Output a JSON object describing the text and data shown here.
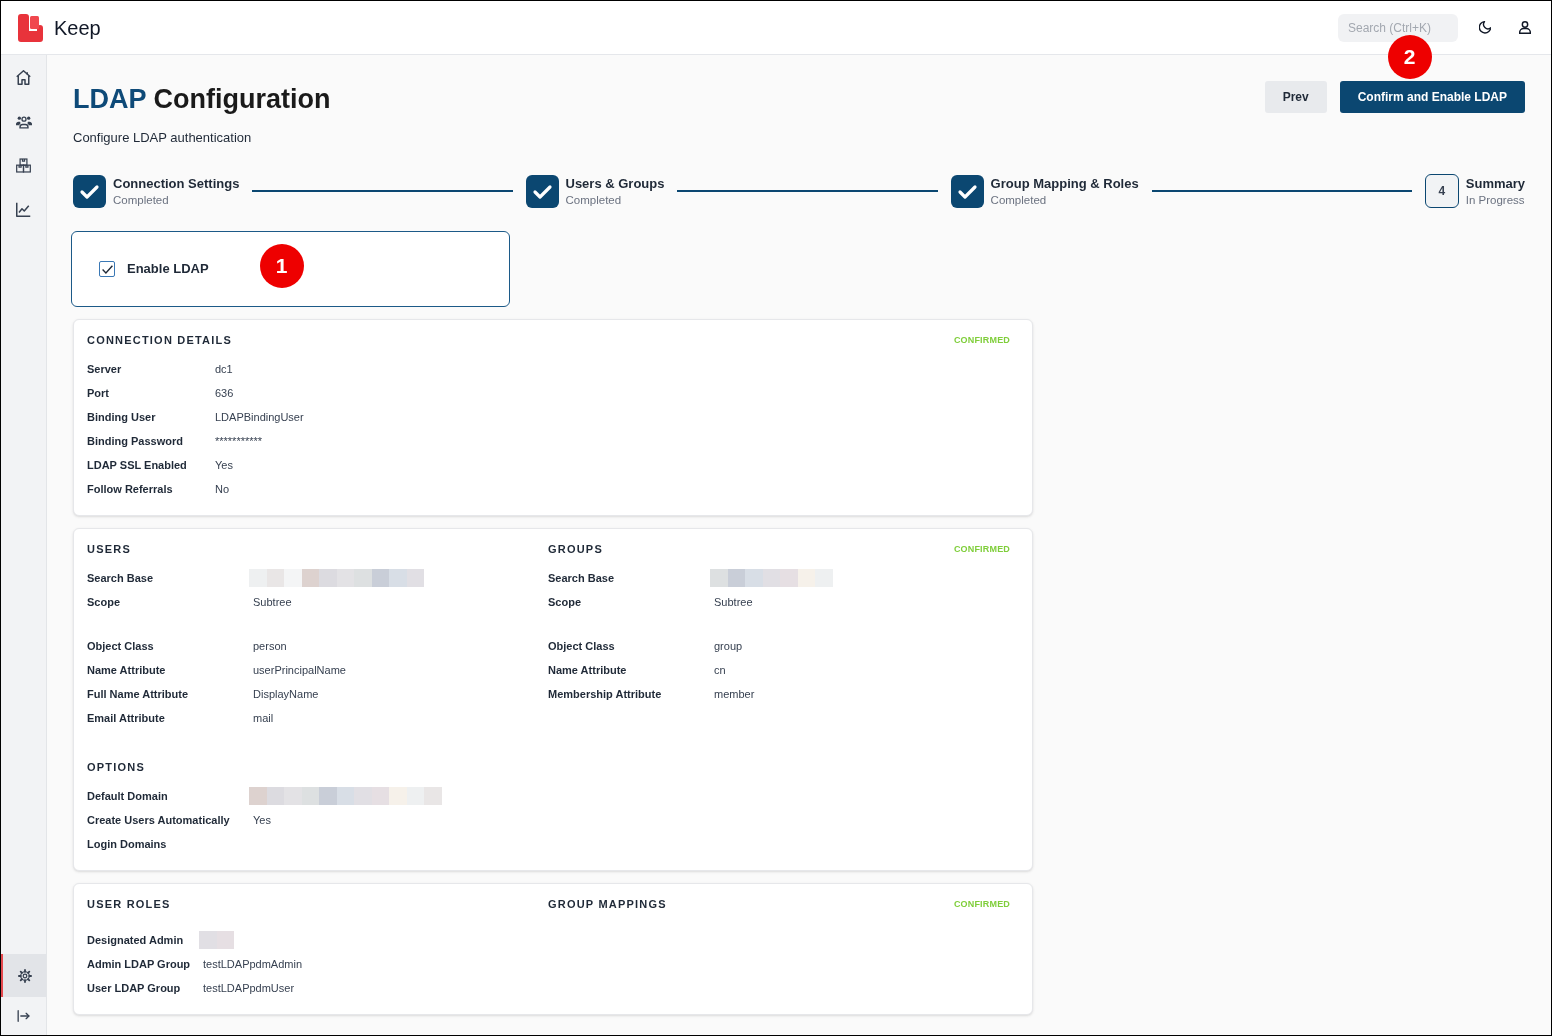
{
  "app": {
    "name": "Keep"
  },
  "header": {
    "search": {
      "placeholder": "Search (Ctrl+K)"
    }
  },
  "sidebar": {
    "items": [
      {
        "selected": false
      },
      {
        "selected": false
      },
      {
        "selected": false
      },
      {
        "selected": false
      },
      {
        "selected": true
      }
    ]
  },
  "page": {
    "title": [
      {
        "text": "LDAP",
        "accent": true
      },
      {
        "text": "Configuration",
        "accent": false
      }
    ],
    "subtitle": "Configure LDAP authentication",
    "buttons": [
      {
        "label": "Prev",
        "kind": "secondary"
      },
      {
        "label": "Confirm and Enable LDAP",
        "kind": "primary",
        "callout": "2"
      }
    ]
  },
  "steps": [
    {
      "title": "Connection Settings",
      "status": "Completed",
      "completed": true
    },
    {
      "title": "Users & Groups",
      "status": "Completed",
      "completed": true
    },
    {
      "title": "Group Mapping & Roles",
      "status": "Completed",
      "completed": true
    },
    {
      "number": "4",
      "title": "Summary",
      "status": "In Progress",
      "completed": false
    }
  ],
  "enable_ldap": {
    "label": "Enable LDAP",
    "checked": true,
    "callout": "1"
  },
  "cards": [
    {
      "status": "CONFIRMED",
      "columns": [
        {
          "sections": [
            {
              "title": "CONNECTION DETAILS",
              "field_groups": [
                [
                  {
                    "label": "Server",
                    "value": "dc1"
                  },
                  {
                    "label": "Port",
                    "value": "636"
                  },
                  {
                    "label": "Binding User",
                    "value": "LDAPBindingUser"
                  },
                  {
                    "label": "Binding Password",
                    "value": "***********"
                  },
                  {
                    "label": "LDAP SSL Enabled",
                    "value": "Yes"
                  },
                  {
                    "label": "Follow Referrals",
                    "value": "No"
                  }
                ]
              ]
            }
          ]
        }
      ]
    },
    {
      "status": "CONFIRMED",
      "columns": [
        {
          "sections": [
            {
              "title": "USERS",
              "field_groups": [
                [
                  {
                    "label": "Search Base",
                    "redacted": true
                  },
                  {
                    "label": "Scope",
                    "value": "Subtree"
                  }
                ],
                [
                  {
                    "label": "Object Class",
                    "value": "person"
                  },
                  {
                    "label": "Name Attribute",
                    "value": "userPrincipalName"
                  },
                  {
                    "label": "Full Name Attribute",
                    "value": "DisplayName"
                  },
                  {
                    "label": "Email Attribute",
                    "value": "mail"
                  }
                ]
              ]
            },
            {
              "title": "OPTIONS",
              "field_groups": [
                [
                  {
                    "label": "Default Domain",
                    "redacted": true
                  },
                  {
                    "label": "Create Users Automatically",
                    "value": "Yes"
                  },
                  {
                    "label": "Login Domains"
                  }
                ]
              ]
            }
          ]
        },
        {
          "sections": [
            {
              "title": "GROUPS",
              "field_groups": [
                [
                  {
                    "label": "Search Base",
                    "redacted": true
                  },
                  {
                    "label": "Scope",
                    "value": "Subtree"
                  }
                ],
                [
                  {
                    "label": "Object Class",
                    "value": "group"
                  },
                  {
                    "label": "Name Attribute",
                    "value": "cn"
                  },
                  {
                    "label": "Membership Attribute",
                    "value": "member"
                  }
                ]
              ]
            }
          ]
        }
      ]
    },
    {
      "status": "CONFIRMED",
      "columns": [
        {
          "sections": [
            {
              "title": "USER ROLES",
              "field_groups": [
                [
                  {
                    "label": "Designated Admin",
                    "redacted": true
                  },
                  {
                    "label": "Admin LDAP Group",
                    "value": "testLDAPpdmAdmin"
                  },
                  {
                    "label": "User LDAP Group",
                    "value": "testLDAPpdmUser"
                  }
                ]
              ]
            }
          ]
        },
        {
          "sections": [
            {
              "title": "GROUP MAPPINGS"
            }
          ]
        }
      ]
    }
  ]
}
